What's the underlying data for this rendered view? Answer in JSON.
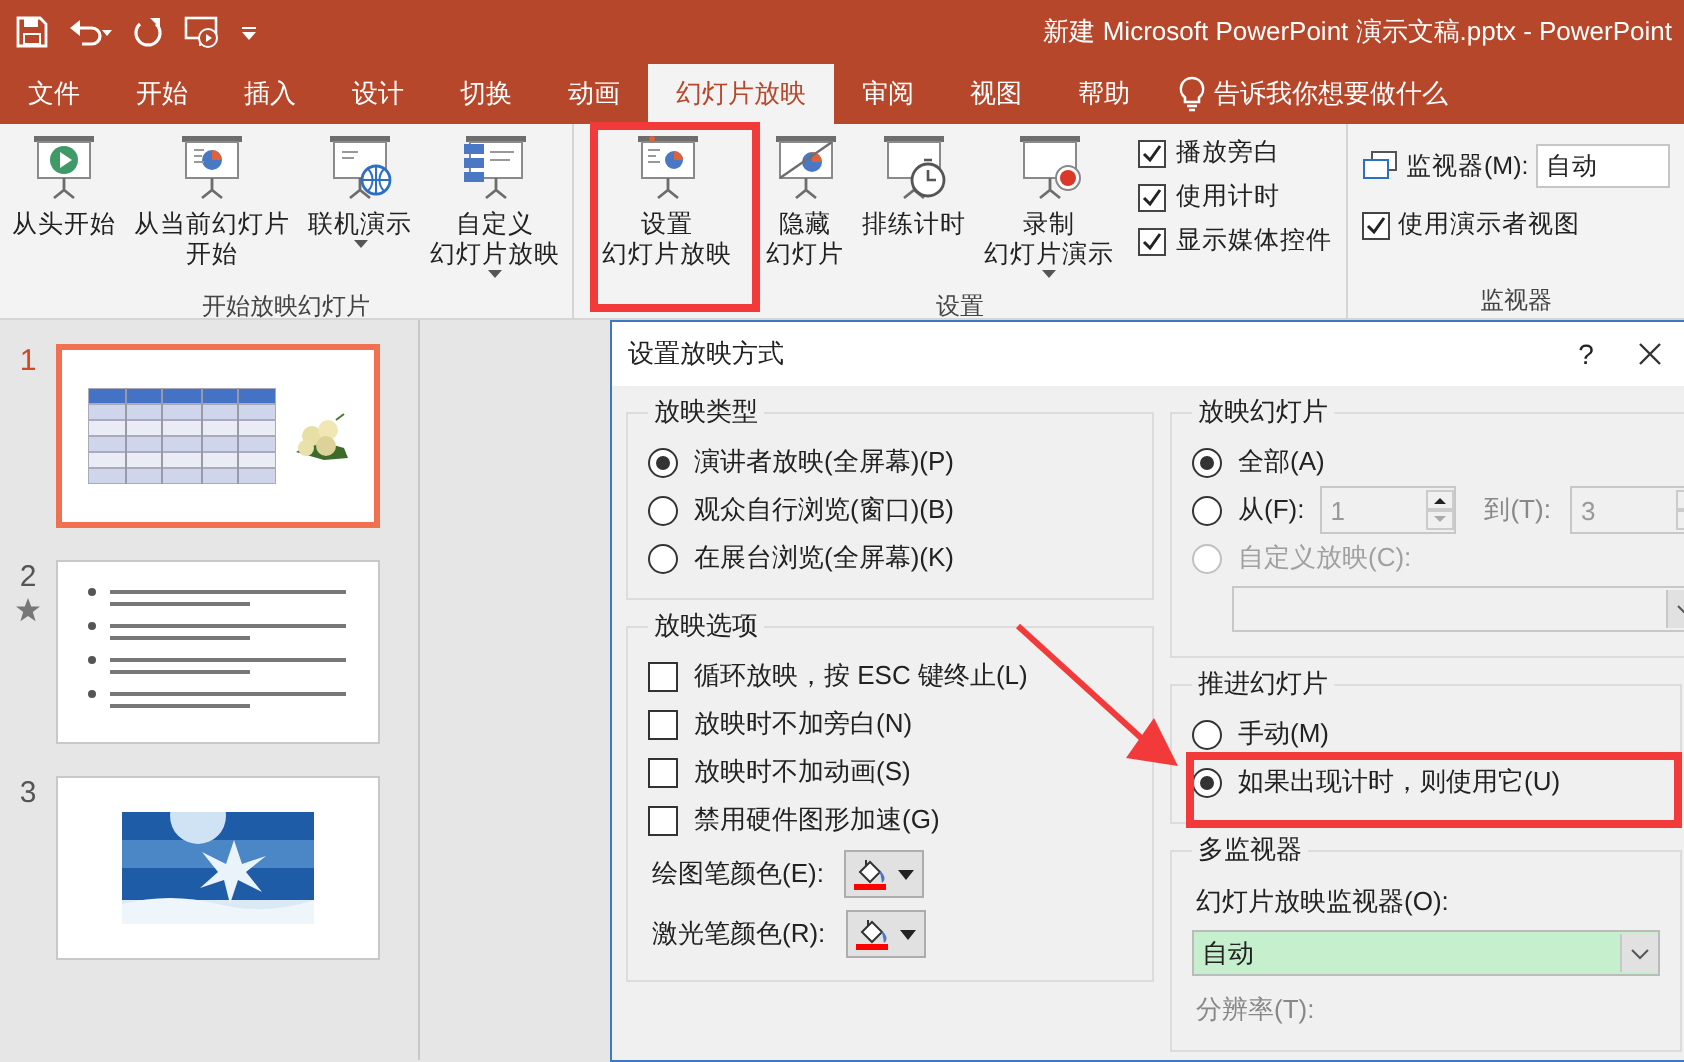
{
  "title_bar": {
    "document_title": "新建 Microsoft PowerPoint 演示文稿.pptx  -  PowerPoint"
  },
  "tabs": [
    {
      "label": "文件",
      "selected": false
    },
    {
      "label": "开始",
      "selected": false
    },
    {
      "label": "插入",
      "selected": false
    },
    {
      "label": "设计",
      "selected": false
    },
    {
      "label": "切换",
      "selected": false
    },
    {
      "label": "动画",
      "selected": false
    },
    {
      "label": "幻灯片放映",
      "selected": true
    },
    {
      "label": "审阅",
      "selected": false
    },
    {
      "label": "视图",
      "selected": false
    },
    {
      "label": "帮助",
      "selected": false
    }
  ],
  "tell_me": "告诉我你想要做什么",
  "ribbon": {
    "groups": [
      {
        "label": "开始放映幻灯片",
        "buttons": [
          {
            "label": [
              "从头开始"
            ],
            "has_menu": false,
            "highlighted": false
          },
          {
            "label": [
              "从当前幻灯片",
              "开始"
            ],
            "has_menu": false,
            "highlighted": false
          },
          {
            "label": [
              "联机演示"
            ],
            "has_menu": true,
            "highlighted": false
          },
          {
            "label": [
              "自定义",
              "幻灯片放映"
            ],
            "has_menu": true,
            "highlighted": false
          }
        ]
      },
      {
        "label": "设置",
        "buttons": [
          {
            "label": [
              "设置",
              "幻灯片放映"
            ],
            "has_menu": false,
            "highlighted": true
          },
          {
            "label": [
              "隐藏",
              "幻灯片"
            ],
            "has_menu": false,
            "highlighted": false
          },
          {
            "label": [
              "排练计时"
            ],
            "has_menu": false,
            "highlighted": false
          },
          {
            "label": [
              "录制",
              "幻灯片演示"
            ],
            "has_menu": true,
            "highlighted": false
          }
        ],
        "checkboxes": [
          {
            "label": "播放旁白",
            "checked": true
          },
          {
            "label": "使用计时",
            "checked": true
          },
          {
            "label": "显示媒体控件",
            "checked": true
          }
        ]
      },
      {
        "label": "监视器",
        "monitor": {
          "label": "监视器(M):",
          "value": "自动"
        },
        "checkboxes": [
          {
            "label": "使用演示者视图",
            "checked": true
          }
        ]
      }
    ]
  },
  "slides": [
    {
      "number": "1",
      "selected": true,
      "animated": false,
      "kind": "table"
    },
    {
      "number": "2",
      "selected": false,
      "animated": true,
      "kind": "bullets"
    },
    {
      "number": "3",
      "selected": false,
      "animated": false
    }
  ],
  "dialog": {
    "title": "设置放映方式",
    "help": "?",
    "show_type": {
      "legend": "放映类型",
      "options": [
        {
          "label": "演讲者放映(全屏幕)(P)",
          "selected": true
        },
        {
          "label": "观众自行浏览(窗口)(B)",
          "selected": false
        },
        {
          "label": "在展台浏览(全屏幕)(K)",
          "selected": false
        }
      ]
    },
    "show_options": {
      "legend": "放映选项",
      "checkboxes": [
        {
          "label": "循环放映，按 ESC 键终止(L)",
          "checked": false
        },
        {
          "label": "放映时不加旁白(N)",
          "checked": false
        },
        {
          "label": "放映时不加动画(S)",
          "checked": false
        },
        {
          "label": "禁用硬件图形加速(G)",
          "checked": false
        }
      ],
      "pens": [
        {
          "label": "绘图笔颜色(E):",
          "color": "#ff0000"
        },
        {
          "label": "激光笔颜色(R):",
          "color": "#ff0000"
        }
      ]
    },
    "show_slides": {
      "legend": "放映幻灯片",
      "options": [
        {
          "kind": "all",
          "label": "全部(A)",
          "selected": true,
          "disabled": false
        },
        {
          "kind": "range",
          "label": "从(F):",
          "selected": false,
          "disabled": false,
          "from": "1",
          "to_label": "到(T):",
          "to": "3"
        },
        {
          "kind": "custom",
          "label": "自定义放映(C):",
          "selected": false,
          "disabled": true
        }
      ]
    },
    "advance": {
      "legend": "推进幻灯片",
      "options": [
        {
          "label": "手动(M)",
          "selected": false,
          "highlighted": false
        },
        {
          "label": "如果出现计时，则使用它(U)",
          "selected": true,
          "highlighted": true
        }
      ]
    },
    "monitors": {
      "legend": "多监视器",
      "monitor_label": "幻灯片放映监视器(O):",
      "monitor_value": "自动",
      "resolution_label": "分辨率(T):"
    }
  }
}
